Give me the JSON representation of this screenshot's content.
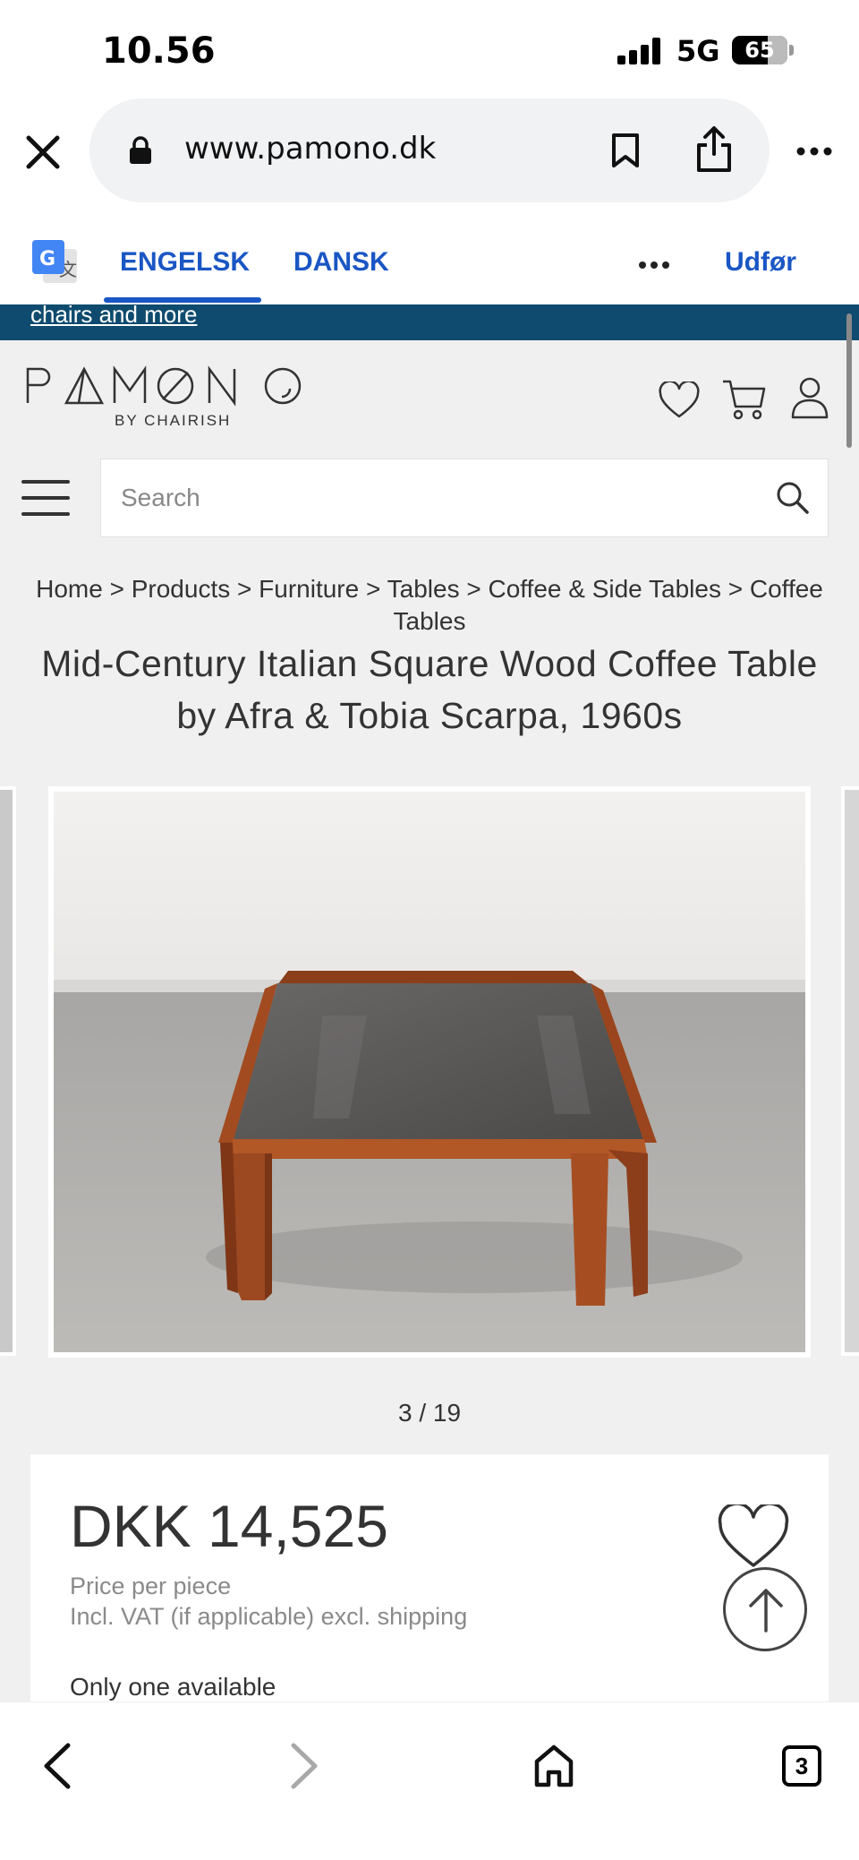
{
  "status_bar": {
    "time": "10.56",
    "network": "5G",
    "battery": "65",
    "battery_level": 0.65
  },
  "browser": {
    "url": "www.pamono.dk",
    "icons": [
      "close-icon",
      "lock-icon",
      "bookmark-icon",
      "share-icon",
      "more-icon"
    ]
  },
  "translate": {
    "source_lang": "ENGELSK",
    "target_lang": "DANSK",
    "action": "Udfør",
    "accent": "#1a56c4"
  },
  "promo": {
    "link_text": "chairs and more",
    "color": "#0e4b6e"
  },
  "site": {
    "logo_text": "PAMONO",
    "logo_sub": "BY CHAIRISH",
    "search_placeholder": "Search"
  },
  "breadcrumb": {
    "items": [
      "Home",
      "Products",
      "Furniture",
      "Tables",
      "Coffee & Side Tables",
      "Coffee Tables"
    ],
    "separator": ">"
  },
  "product": {
    "title": "Mid-Century Italian Square Wood Coffee Table by Afra & Tobia Scarpa, 1960s",
    "gallery_counter": "3 / 19",
    "price": "DKK 14,525",
    "price_note_1": "Price per piece",
    "price_note_2": "Incl. VAT (if applicable) excl. shipping",
    "availability": "Only one available"
  },
  "bottom_bar": {
    "tab_count": "3"
  }
}
